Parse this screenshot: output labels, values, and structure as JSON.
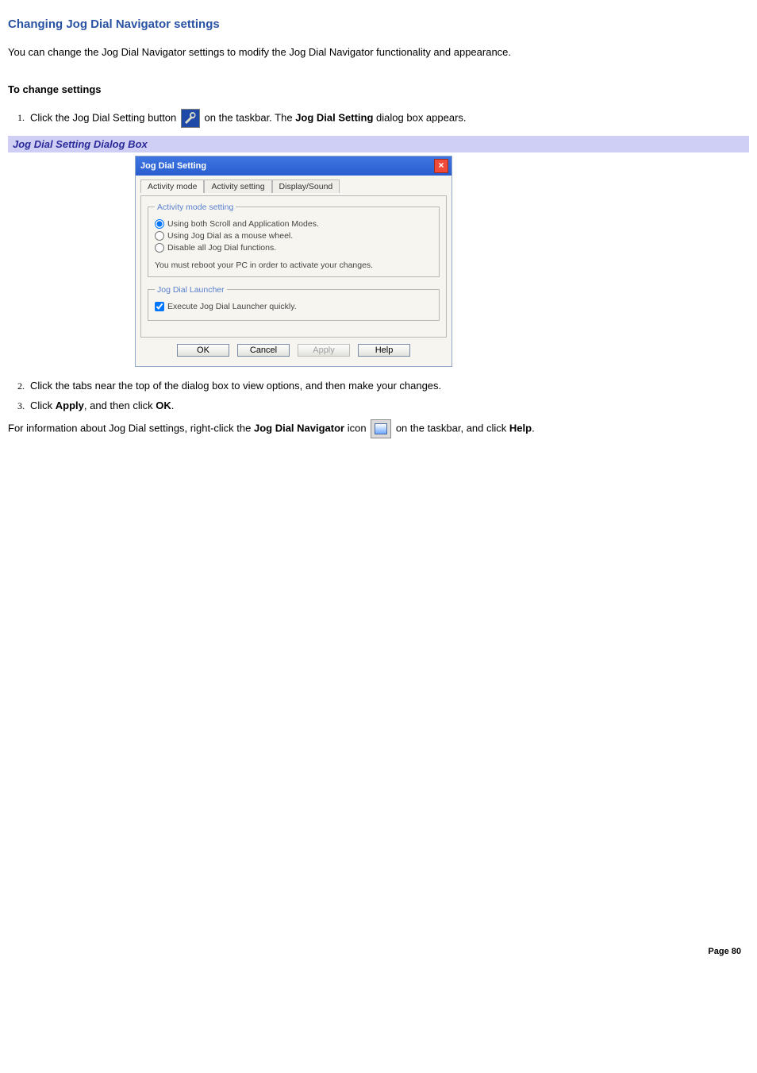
{
  "page": {
    "title": "Changing Jog Dial Navigator settings",
    "intro": "You can change the Jog Dial Navigator settings to modify the Jog Dial Navigator functionality and appearance.",
    "subheading": "To change settings",
    "caption": "Jog Dial Setting Dialog Box",
    "page_number": "Page 80"
  },
  "steps": {
    "s1_a": "Click the Jog Dial Setting button ",
    "s1_b": "on the taskbar. The ",
    "s1_bold": "Jog Dial Setting",
    "s1_c": " dialog box appears.",
    "s2": "Click the tabs near the top of the dialog box to view options, and then make your changes.",
    "s3_a": "Click ",
    "s3_bold1": "Apply",
    "s3_b": ", and then click ",
    "s3_bold2": "OK",
    "s3_c": "."
  },
  "footer": {
    "a": "For information about Jog Dial settings, right-click the ",
    "bold1": "Jog Dial Navigator",
    "b": " icon ",
    "c": "on the taskbar, and click ",
    "bold2": "Help",
    "d": "."
  },
  "dialog": {
    "title": "Jog Dial Setting",
    "tabs": [
      "Activity mode",
      "Activity setting",
      "Display/Sound"
    ],
    "fieldset1_legend": "Activity mode setting",
    "radio1": "Using both Scroll and Application Modes.",
    "radio2": "Using Jog Dial as a mouse wheel.",
    "radio3": "Disable all Jog Dial functions.",
    "note": "You must reboot your PC in order to activate your changes.",
    "fieldset2_legend": "Jog Dial Launcher",
    "checkbox": "Execute Jog Dial Launcher quickly.",
    "buttons": {
      "ok": "OK",
      "cancel": "Cancel",
      "apply": "Apply",
      "help": "Help"
    }
  }
}
